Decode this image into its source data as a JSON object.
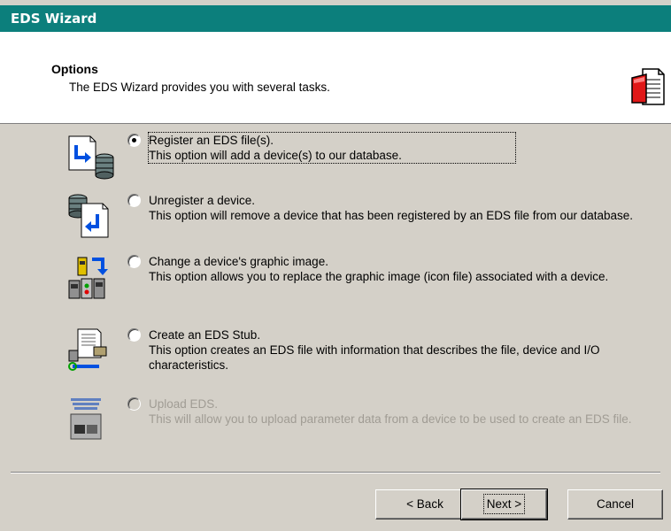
{
  "window": {
    "title": "EDS Wizard"
  },
  "header": {
    "title": "Options",
    "subtitle": "The EDS Wizard provides you with several tasks.",
    "icon": "document-icon"
  },
  "options": [
    {
      "label": "Register an EDS file(s).",
      "description": "This option will add a device(s) to our database.",
      "checked": true,
      "enabled": true,
      "icon": "register-eds-icon"
    },
    {
      "label": "Unregister a device.",
      "description": "This option will remove a device that has been registered by an EDS file from our database.",
      "checked": false,
      "enabled": true,
      "icon": "unregister-device-icon"
    },
    {
      "label": "Change a device's graphic image.",
      "description": "This option allows you to replace the graphic image (icon file) associated with a device.",
      "checked": false,
      "enabled": true,
      "icon": "change-graphic-icon"
    },
    {
      "label": "Create an EDS Stub.",
      "description": "This option creates an EDS file with information that describes the file, device and I/O characteristics.",
      "checked": false,
      "enabled": true,
      "icon": "create-stub-icon"
    },
    {
      "label": "Upload EDS.",
      "description": "This will allow you to upload parameter data from a device to be used to create an EDS file.",
      "checked": false,
      "enabled": false,
      "icon": "upload-eds-icon"
    }
  ],
  "buttons": {
    "back": "< Back",
    "next": "Next >",
    "cancel": "Cancel"
  },
  "colors": {
    "title_bar": "#0c7f7c",
    "dialog_bg": "#d4d0c8",
    "disabled_text": "#a09c94"
  }
}
